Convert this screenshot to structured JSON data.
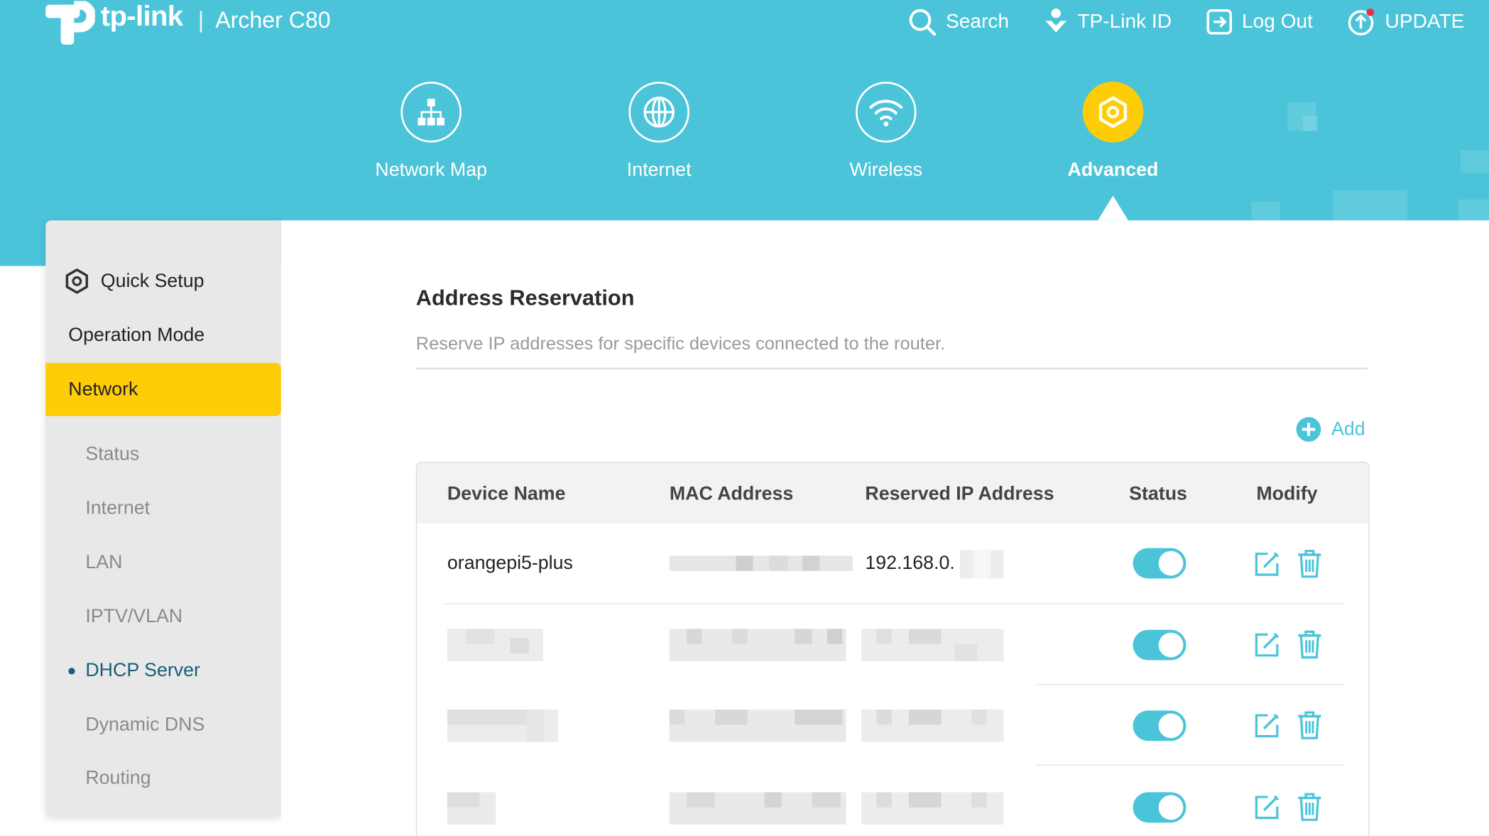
{
  "header": {
    "brand": "tp-link",
    "separator": "|",
    "model": "Archer C80",
    "links": [
      {
        "label": "Search",
        "icon": "search-icon"
      },
      {
        "label": "TP-Link ID",
        "icon": "user-icon"
      },
      {
        "label": "Log Out",
        "icon": "logout-icon"
      },
      {
        "label": "UPDATE",
        "icon": "update-icon"
      }
    ]
  },
  "nav": [
    {
      "label": "Network Map",
      "icon": "network-map-icon"
    },
    {
      "label": "Internet",
      "icon": "globe-icon"
    },
    {
      "label": "Wireless",
      "icon": "wifi-icon"
    },
    {
      "label": "Advanced",
      "icon": "gear-icon",
      "active": true
    }
  ],
  "sidebar": {
    "items": [
      {
        "label": "Quick Setup",
        "icon": "gear-icon"
      },
      {
        "label": "Operation Mode"
      },
      {
        "label": "Network",
        "active": true
      },
      {
        "label": "Status"
      },
      {
        "label": "Internet"
      },
      {
        "label": "LAN"
      },
      {
        "label": "IPTV/VLAN"
      },
      {
        "label": "DHCP Server",
        "current": true
      },
      {
        "label": "Dynamic DNS"
      },
      {
        "label": "Routing"
      }
    ]
  },
  "main": {
    "title": "Address Reservation",
    "description": "Reserve IP addresses for specific devices connected to the router.",
    "add_label": "Add",
    "columns": [
      "Device Name",
      "MAC Address",
      "Reserved IP Address",
      "Status",
      "Modify"
    ],
    "rows": [
      {
        "device": "orangepi5-plus",
        "mac": "",
        "ip": "192.168.0.",
        "status": "on"
      },
      {
        "device": "",
        "mac": "",
        "ip": "",
        "status": "on"
      },
      {
        "device": "",
        "mac": "",
        "ip": "",
        "status": "on"
      },
      {
        "device": "",
        "mac": "",
        "ip": "",
        "status": "on"
      }
    ]
  },
  "colors": {
    "accent": "#4bc4d9",
    "active": "#fecd08",
    "sidebar_bg": "#e8e8e8",
    "current_sub": "#1a5e7a"
  }
}
